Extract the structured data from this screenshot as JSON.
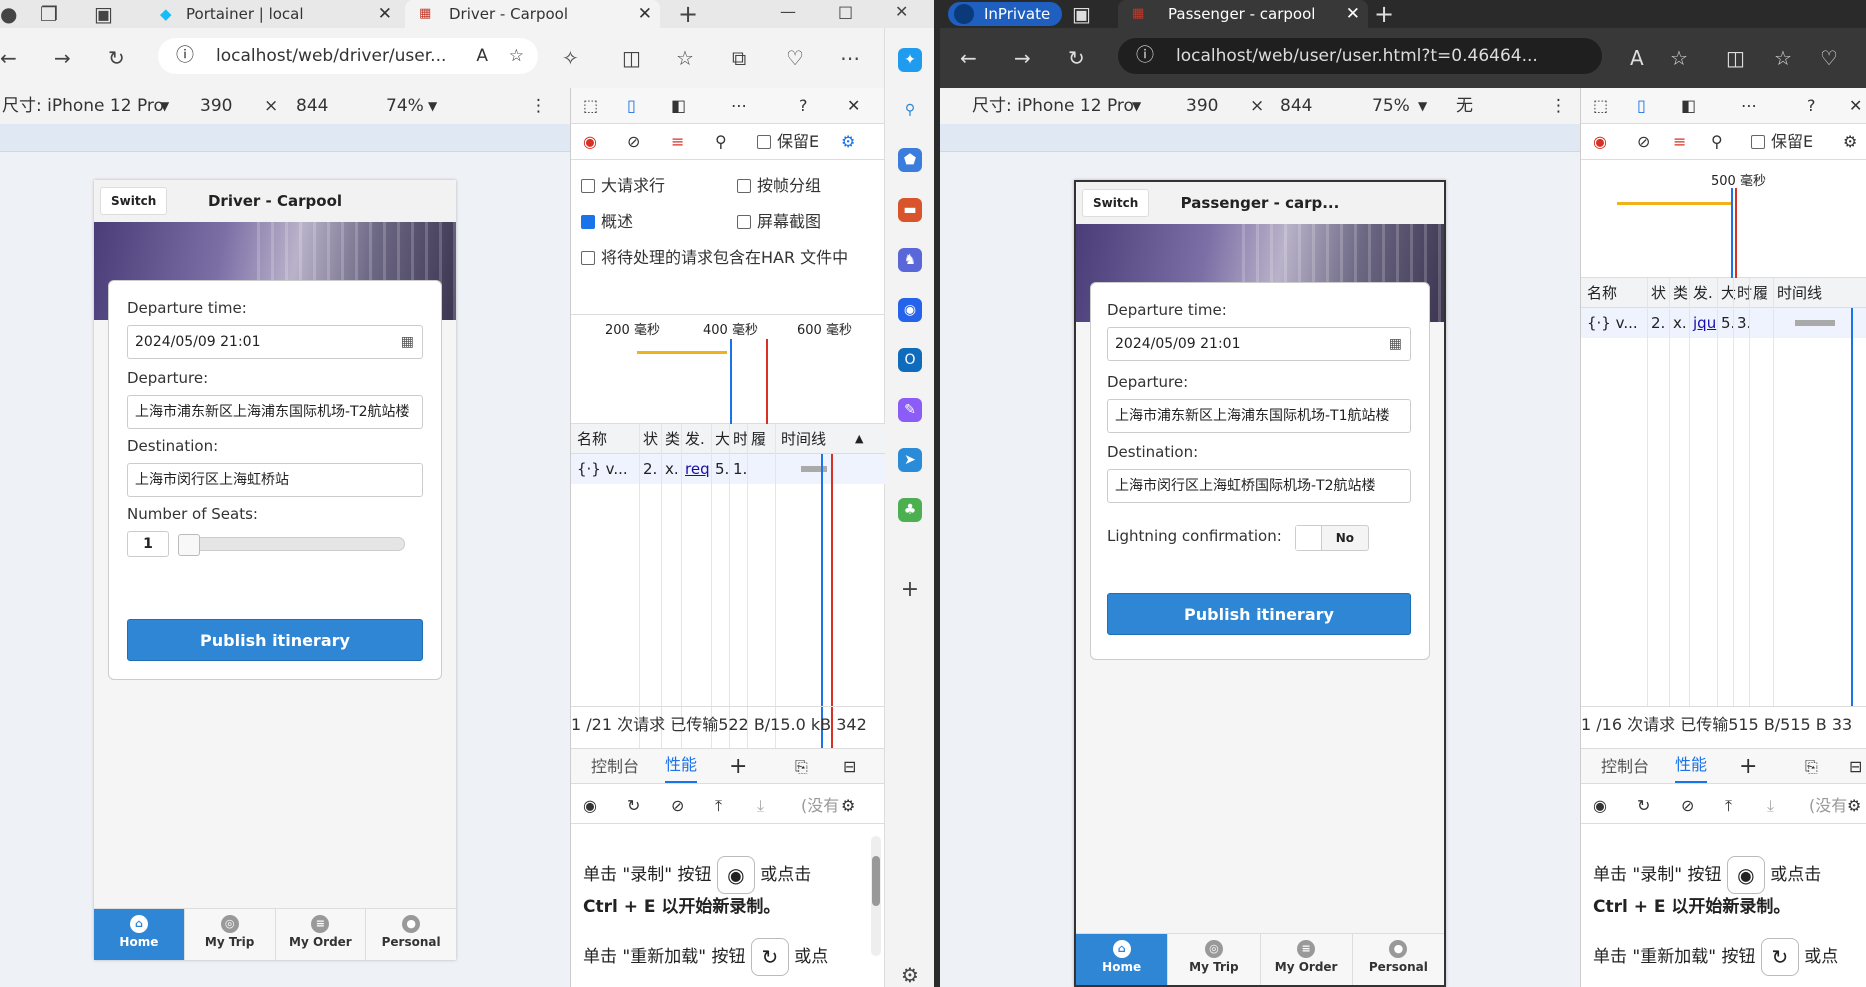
{
  "left": {
    "tabs": [
      {
        "title": "Portainer | local"
      },
      {
        "title": "Driver - Carpool"
      }
    ],
    "url": "localhost/web/driver/user...",
    "device": {
      "name": "尺寸: iPhone 12 Pro",
      "width": "390",
      "x": "×",
      "height": "844",
      "zoom": "74%"
    },
    "app": {
      "switch_label": "Switch",
      "title": "Driver - Carpool",
      "departure_time_label": "Departure time:",
      "departure_time_value": "2024/05/09 21:01",
      "departure_label": "Departure:",
      "departure_value": "上海市浦东新区上海浦东国际机场-T2航站楼",
      "destination_label": "Destination:",
      "destination_value": "上海市闵行区上海虹桥站",
      "seats_label": "Number of Seats:",
      "seats_value": "1",
      "publish_label": "Publish itinerary",
      "nav": [
        "Home",
        "My Trip",
        "My Order",
        "Personal"
      ]
    },
    "devtools": {
      "preserve_log": "保留E",
      "opt_big_rows": "大请求行",
      "opt_group_frames": "按帧分组",
      "opt_overview": "概述",
      "opt_screenshots": "屏幕截图",
      "opt_har": "将待处理的请求包含在HAR 文件中",
      "ticks": [
        "200 毫秒",
        "400 毫秒",
        "600 毫秒"
      ],
      "columns": [
        "名称",
        "状",
        "类",
        "发.",
        "大",
        "时",
        "履",
        "时间线"
      ],
      "row": [
        "{·} v...",
        "2.",
        "x.",
        "req",
        "5.",
        "1."
      ],
      "status": "1 /21 次请求  已传输522 B/15.0 kB  342",
      "drawer_tabs": [
        "控制台",
        "性能"
      ],
      "no_profile": "(没有",
      "hint1a": "单击 \"录制\" 按钮",
      "hint1b": "或点击",
      "hint1c": "Ctrl + E 以开始新录制。",
      "hint2a": "单击 \"重新加载\" 按钮",
      "hint2b": "或点"
    }
  },
  "right": {
    "inprivate": "InPrivate",
    "tabs": [
      {
        "title": "Passenger - carpool"
      }
    ],
    "url": "localhost/web/user/user.html?t=0.46464...",
    "device": {
      "name": "尺寸: iPhone 12 Pro",
      "width": "390",
      "x": "×",
      "height": "844",
      "zoom": "75%",
      "throttle": "无"
    },
    "app": {
      "switch_label": "Switch",
      "title": "Passenger - carp...",
      "departure_time_label": "Departure time:",
      "departure_time_value": "2024/05/09 21:01",
      "departure_label": "Departure:",
      "departure_value": "上海市浦东新区上海浦东国际机场-T1航站楼",
      "destination_label": "Destination:",
      "destination_value": "上海市闵行区上海虹桥国际机场-T2航站楼",
      "lightning_label": "Lightning confirmation:",
      "lightning_value": "No",
      "publish_label": "Publish itinerary",
      "nav": [
        "Home",
        "My Trip",
        "My Order",
        "Personal"
      ]
    },
    "devtools": {
      "preserve_log": "保留E",
      "ticks": [
        "500 毫秒"
      ],
      "columns": [
        "名称",
        "状",
        "类",
        "发.",
        "大",
        "时",
        "履",
        "时间线"
      ],
      "row": [
        "{·} v...",
        "2.",
        "x.",
        "jqu",
        "5.",
        "3."
      ],
      "status": "1 /16 次请求  已传输515 B/515 B  33",
      "drawer_tabs": [
        "控制台",
        "性能"
      ],
      "no_profile": "(没有",
      "hint1a": "单击 \"录制\" 按钮",
      "hint1b": "或点击",
      "hint1c": "Ctrl + E 以开始新录制。",
      "hint2a": "单击 \"重新加载\" 按钮",
      "hint2b": "或点"
    }
  },
  "colors": {
    "accent": "#2e86d4",
    "devtools_blue": "#1a73e8",
    "inprivate": "#1f5fbf"
  }
}
